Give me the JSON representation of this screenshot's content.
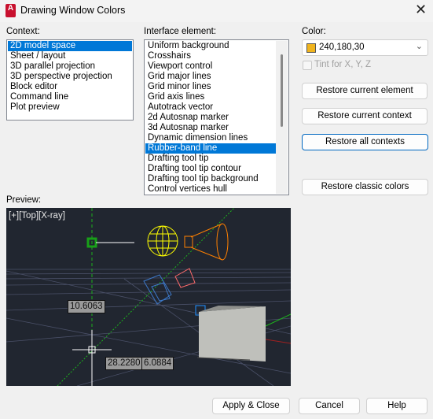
{
  "window": {
    "title": "Drawing Window Colors",
    "app_icon_letter": "A"
  },
  "context": {
    "label": "Context:",
    "items": [
      "2D model space",
      "Sheet / layout",
      "3D parallel projection",
      "3D perspective projection",
      "Block editor",
      "Command line",
      "Plot preview"
    ],
    "selected": "2D model space"
  },
  "interface": {
    "label": "Interface element:",
    "items": [
      "Uniform background",
      "Crosshairs",
      "Viewport control",
      "Grid major lines",
      "Grid minor lines",
      "Grid axis lines",
      "Autotrack vector",
      "2d Autosnap marker",
      "3d Autosnap marker",
      "Dynamic dimension lines",
      "Rubber-band line",
      "Drafting tool tip",
      "Drafting tool tip contour",
      "Drafting tool tip background",
      "Control vertices hull"
    ],
    "selected": "Rubber-band line"
  },
  "color": {
    "label": "Color:",
    "value": "240,180,30",
    "swatch": "#f0b41e",
    "tint_label": "Tint for X, Y, Z",
    "tint_checked": false,
    "tint_enabled": false
  },
  "buttons": {
    "restore_element": "Restore current element",
    "restore_context": "Restore current context",
    "restore_all": "Restore all contexts",
    "restore_classic": "Restore classic colors",
    "apply": "Apply & Close",
    "cancel": "Cancel",
    "help": "Help"
  },
  "preview": {
    "label": "Preview:",
    "viewport_label": "[+][Top][X-ray]",
    "dim1": "10.6063",
    "dim2": "28.2280",
    "dim3": "6.0884",
    "background": "#212630"
  }
}
